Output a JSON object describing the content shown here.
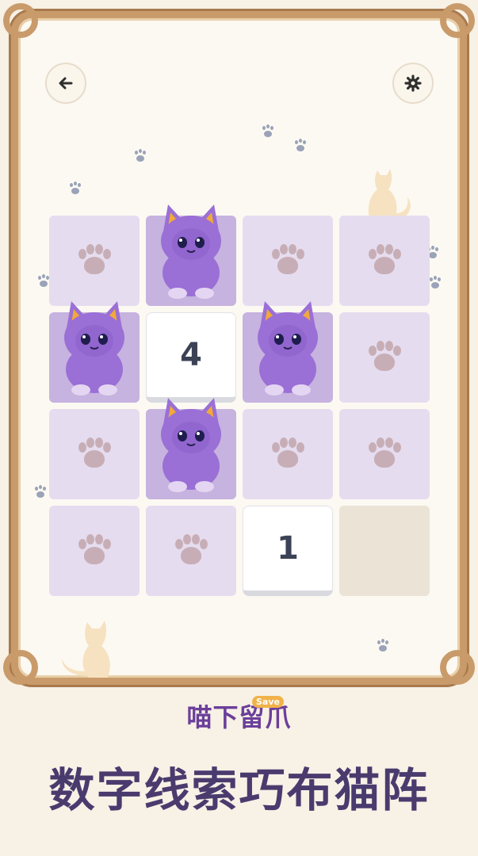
{
  "header": {
    "back_icon": "arrow-left-icon",
    "settings_icon": "gear-icon"
  },
  "board": {
    "rows": 4,
    "cols": 4,
    "cells": [
      [
        "paw",
        "cat",
        "paw",
        "paw"
      ],
      [
        "cat",
        "4",
        "cat",
        "paw"
      ],
      [
        "paw",
        "cat",
        "paw",
        "paw"
      ],
      [
        "paw",
        "paw",
        "1",
        "empty"
      ]
    ]
  },
  "colors": {
    "cell_empty_bg": "#e6dcef",
    "cell_cat_bg": "#c6b3df",
    "cat_body": "#9a6fd6",
    "number_text": "#3b4256",
    "title": "#4a3b6e"
  },
  "branding": {
    "logo": "喵下留爪",
    "badge": "Save"
  },
  "headline": "数字线索巧布猫阵"
}
